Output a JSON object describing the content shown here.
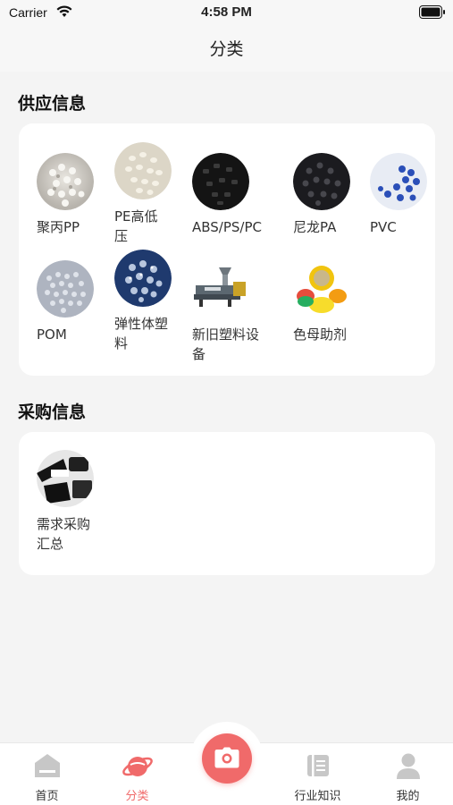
{
  "status_bar": {
    "carrier": "Carrier",
    "time": "4:58 PM"
  },
  "nav": {
    "title": "分类"
  },
  "supply": {
    "title": "供应信息",
    "items": [
      {
        "label": "聚丙PP",
        "icon": "pp-pellets-image"
      },
      {
        "label": "PE高低\n压",
        "icon": "pe-pellets-image"
      },
      {
        "label": "ABS/PS/PC",
        "icon": "abs-pellets-image"
      },
      {
        "label": "尼龙PA",
        "icon": "pa-pellets-image"
      },
      {
        "label": "PVC",
        "icon": "pvc-pellets-image"
      },
      {
        "label": "POM",
        "icon": "pom-pellets-image"
      },
      {
        "label": "弹性体塑\n料",
        "icon": "elastomer-pellets-image"
      },
      {
        "label": "新旧塑料设\n备",
        "icon": "extruder-machine-image"
      },
      {
        "label": "色母助剂",
        "icon": "masterbatch-image"
      }
    ]
  },
  "purchase": {
    "title": "采购信息",
    "items": [
      {
        "label": "需求采购\n汇总",
        "icon": "purchase-summary-image"
      }
    ]
  },
  "tab_bar": {
    "items": [
      {
        "label": "首页",
        "icon": "home-icon",
        "active": false
      },
      {
        "label": "分类",
        "icon": "planet-icon",
        "active": true
      },
      {
        "label": "行业知识",
        "icon": "book-icon",
        "active": false
      },
      {
        "label": "我的",
        "icon": "user-icon",
        "active": false
      }
    ],
    "camera_icon": "camera-icon"
  },
  "colors": {
    "accent": "#f06a6a",
    "inactive_icon": "#c7c7c7",
    "background": "#f4f4f4",
    "card": "#ffffff"
  }
}
